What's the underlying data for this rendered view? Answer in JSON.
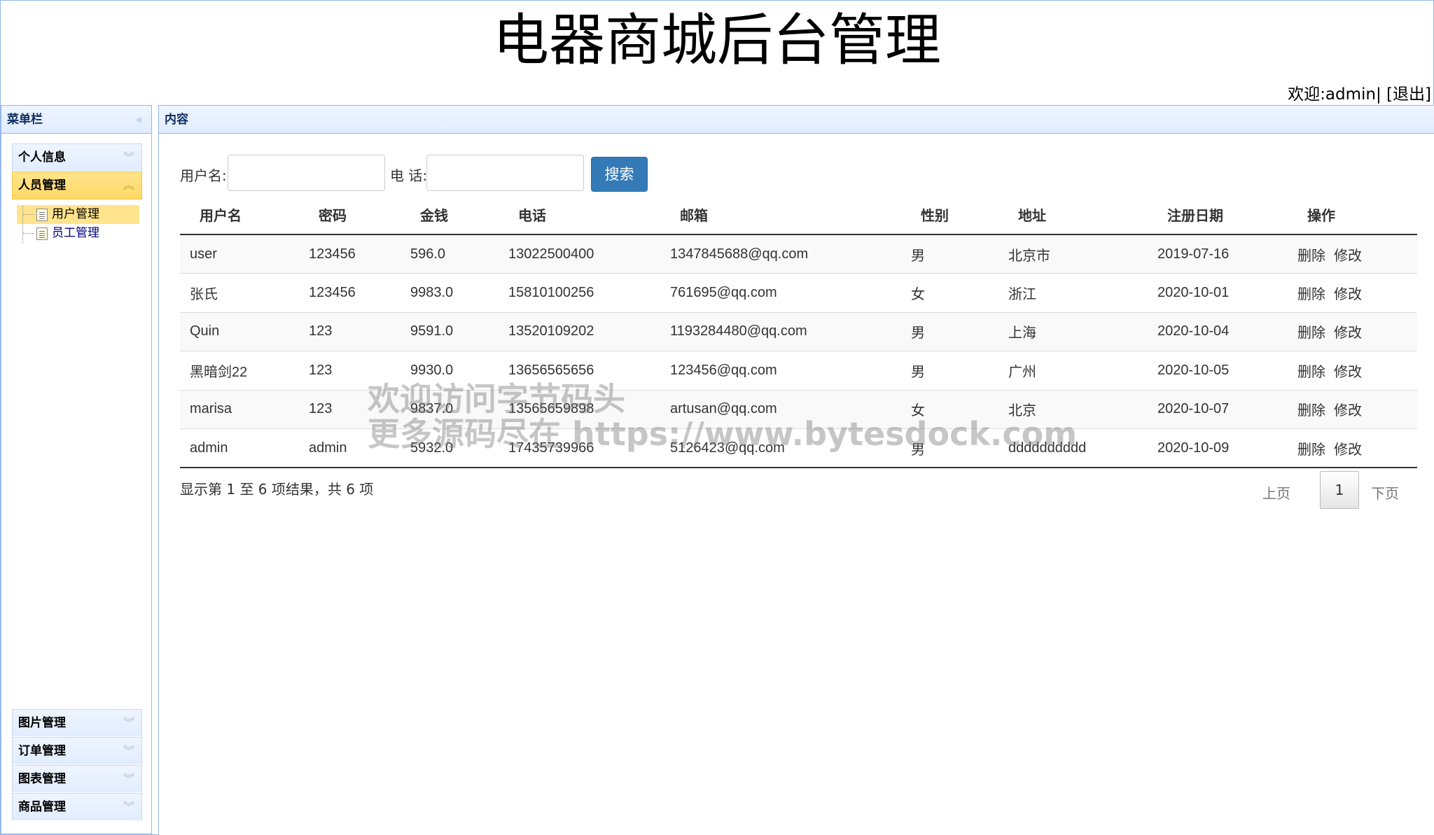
{
  "header": {
    "title": "电器商城后台管理",
    "welcome_prefix": "欢迎:",
    "username": "admin",
    "separator": "|",
    "logout": "[退出]"
  },
  "sidebar": {
    "title": "菜单栏",
    "sections": [
      {
        "label": "个人信息",
        "expanded": false
      },
      {
        "label": "人员管理",
        "expanded": true,
        "items": [
          {
            "label": "用户管理",
            "selected": true
          },
          {
            "label": "员工管理",
            "selected": false
          }
        ]
      },
      {
        "label": "图片管理",
        "expanded": false
      },
      {
        "label": "订单管理",
        "expanded": false
      },
      {
        "label": "图表管理",
        "expanded": false
      },
      {
        "label": "商品管理",
        "expanded": false
      }
    ]
  },
  "content": {
    "title": "内容",
    "search": {
      "username_label": "用户名:",
      "username_value": "",
      "phone_label": "电 话:",
      "phone_value": "",
      "button": "搜索"
    },
    "table": {
      "columns": [
        "用户名",
        "密码",
        "金钱",
        "电话",
        "邮箱",
        "性别",
        "地址",
        "注册日期",
        "操作"
      ],
      "rows": [
        {
          "username": "user",
          "password": "123456",
          "money": "596.0",
          "phone": "13022500400",
          "email": "1347845688@qq.com",
          "gender": "男",
          "address": "北京市",
          "date": "2019-07-16"
        },
        {
          "username": "张氏",
          "password": "123456",
          "money": "9983.0",
          "phone": "15810100256",
          "email": "761695@qq.com",
          "gender": "女",
          "address": "浙江",
          "date": "2020-10-01"
        },
        {
          "username": "Quin",
          "password": "123",
          "money": "9591.0",
          "phone": "13520109202",
          "email": "1193284480@qq.com",
          "gender": "男",
          "address": "上海",
          "date": "2020-10-04"
        },
        {
          "username": "黑暗剑22",
          "password": "123",
          "money": "9930.0",
          "phone": "13656565656",
          "email": "123456@qq.com",
          "gender": "男",
          "address": "广州",
          "date": "2020-10-05"
        },
        {
          "username": "marisa",
          "password": "123",
          "money": "9837.0",
          "phone": "13565659898",
          "email": "artusan@qq.com",
          "gender": "女",
          "address": "北京",
          "date": "2020-10-07"
        },
        {
          "username": "admin",
          "password": "admin",
          "money": "5932.0",
          "phone": "17435739966",
          "email": "5126423@qq.com",
          "gender": "男",
          "address": "dddddddddd",
          "date": "2020-10-09"
        }
      ],
      "delete_label": "删除",
      "edit_label": "修改"
    },
    "info": "显示第 1 至 6 项结果，共 6 项",
    "pagination": {
      "prev": "上页",
      "current": "1",
      "next": "下页"
    }
  },
  "watermark": {
    "line1": "欢迎访问字节码头",
    "line2": "更多源码尽在 https://www.bytesdock.com"
  }
}
